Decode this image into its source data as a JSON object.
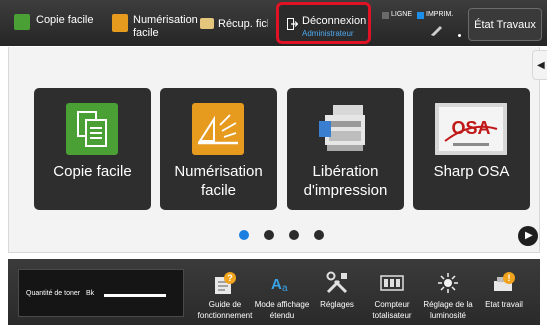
{
  "topbar": {
    "copy_label": "Copie facile",
    "scan_label_line1": "Numérisation",
    "scan_label_line2": "facile",
    "recup_label": "Récup. fich",
    "logout_label": "Déconnexion",
    "logout_sub": "Administrateur",
    "ligne_label": "LIGNE",
    "imprim_label": "IMPRIM.",
    "etat_label": "État Travaux",
    "colors": {
      "highlight": "#e01226",
      "accent": "#1d7fe0",
      "copy_green": "#4aa035",
      "scan_orange": "#e69a1e"
    }
  },
  "tiles": [
    {
      "line1": "Copie facile",
      "line2": "",
      "icon": "copy-icon"
    },
    {
      "line1": "Numérisation",
      "line2": "facile",
      "icon": "scan-icon"
    },
    {
      "line1": "Libération",
      "line2": "d'impression",
      "icon": "print-release-icon"
    },
    {
      "line1": "Sharp OSA",
      "line2": "",
      "icon": "osa-icon"
    }
  ],
  "osa_logo_text": "OSA",
  "pagination": {
    "pages": 4,
    "active": 1
  },
  "bottombar": {
    "toner_label": "Quantité de toner",
    "toner_color": "Bk",
    "items": [
      {
        "line1": "Guide de",
        "line2": "fonctionnement",
        "icon": "guide-icon"
      },
      {
        "line1": "Mode affichage",
        "line2": "étendu",
        "icon": "display-mode-icon"
      },
      {
        "line1": "Réglages",
        "line2": "",
        "icon": "settings-icon"
      },
      {
        "line1": "Compteur",
        "line2": "totalisateur",
        "icon": "counter-icon"
      },
      {
        "line1": "Réglage de la",
        "line2": "luminosité",
        "icon": "brightness-icon"
      },
      {
        "line1": "Etat travail",
        "line2": "",
        "icon": "job-status-icon"
      }
    ]
  }
}
